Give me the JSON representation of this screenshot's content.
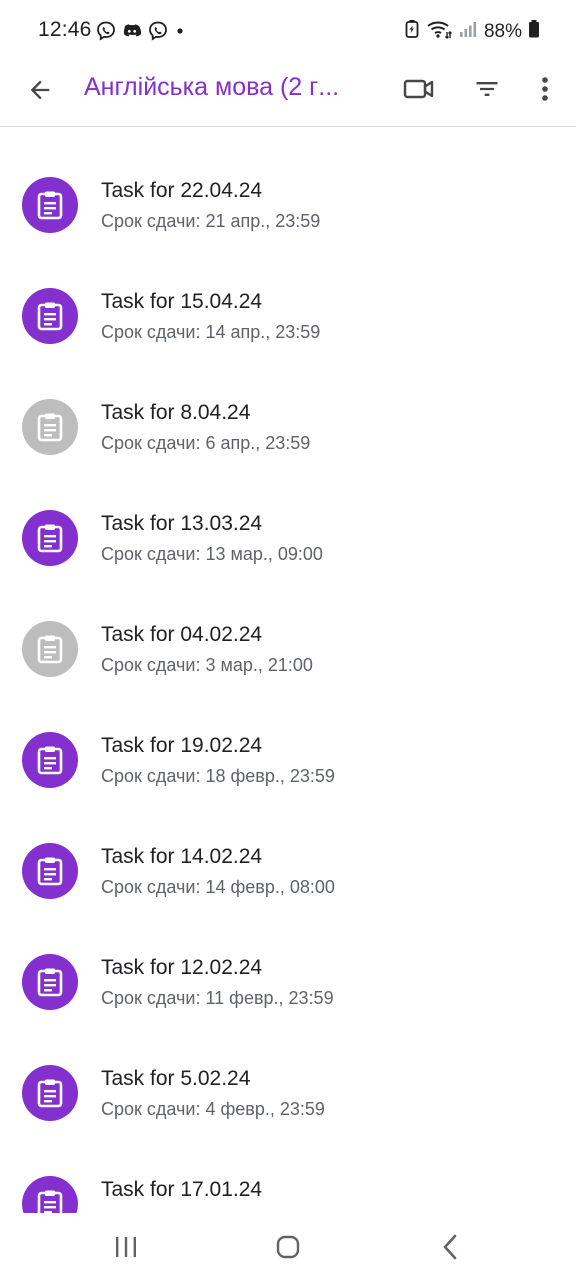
{
  "status_bar": {
    "time": "12:46",
    "notification_icons": [
      "viber-icon",
      "discord-icon",
      "viber-icon",
      "dot-icon"
    ],
    "system_icons": [
      "battery-saver-icon",
      "wifi-icon",
      "signal-icon"
    ],
    "battery_percent": "88%"
  },
  "app_bar": {
    "title": "Англійська мова (2 г",
    "title_ellipsis": "...",
    "accent_color": "#8430ce"
  },
  "tasks": [
    {
      "title": "Task for 22.04.24",
      "due": "Срок сдачи: 21 апр., 23:59",
      "state": "active"
    },
    {
      "title": "Task for 15.04.24",
      "due": "Срок сдачи: 14 апр., 23:59",
      "state": "active"
    },
    {
      "title": "Task for 8.04.24",
      "due": "Срок сдачи: 6 апр., 23:59",
      "state": "inactive"
    },
    {
      "title": "Task for 13.03.24",
      "due": "Срок сдачи: 13 мар., 09:00",
      "state": "active"
    },
    {
      "title": "Task for 04.02.24",
      "due": "Срок сдачи: 3 мар., 21:00",
      "state": "inactive"
    },
    {
      "title": "Task for 19.02.24",
      "due": "Срок сдачи: 18 февр., 23:59",
      "state": "active"
    },
    {
      "title": "Task for 14.02.24",
      "due": "Срок сдачи: 14 февр., 08:00",
      "state": "active"
    },
    {
      "title": "Task for 12.02.24",
      "due": "Срок сдачи: 11 февр., 23:59",
      "state": "active"
    },
    {
      "title": "Task for 5.02.24",
      "due": "Срок сдачи: 4 февр., 23:59",
      "state": "active"
    },
    {
      "title": "Task for 17.01.24",
      "due": "",
      "state": "active"
    }
  ],
  "colors": {
    "active_icon": "#8430ce",
    "inactive_icon": "#bdbdbd"
  },
  "nav_bar": {
    "icons": [
      "recent-apps-icon",
      "home-icon",
      "back-icon"
    ]
  }
}
